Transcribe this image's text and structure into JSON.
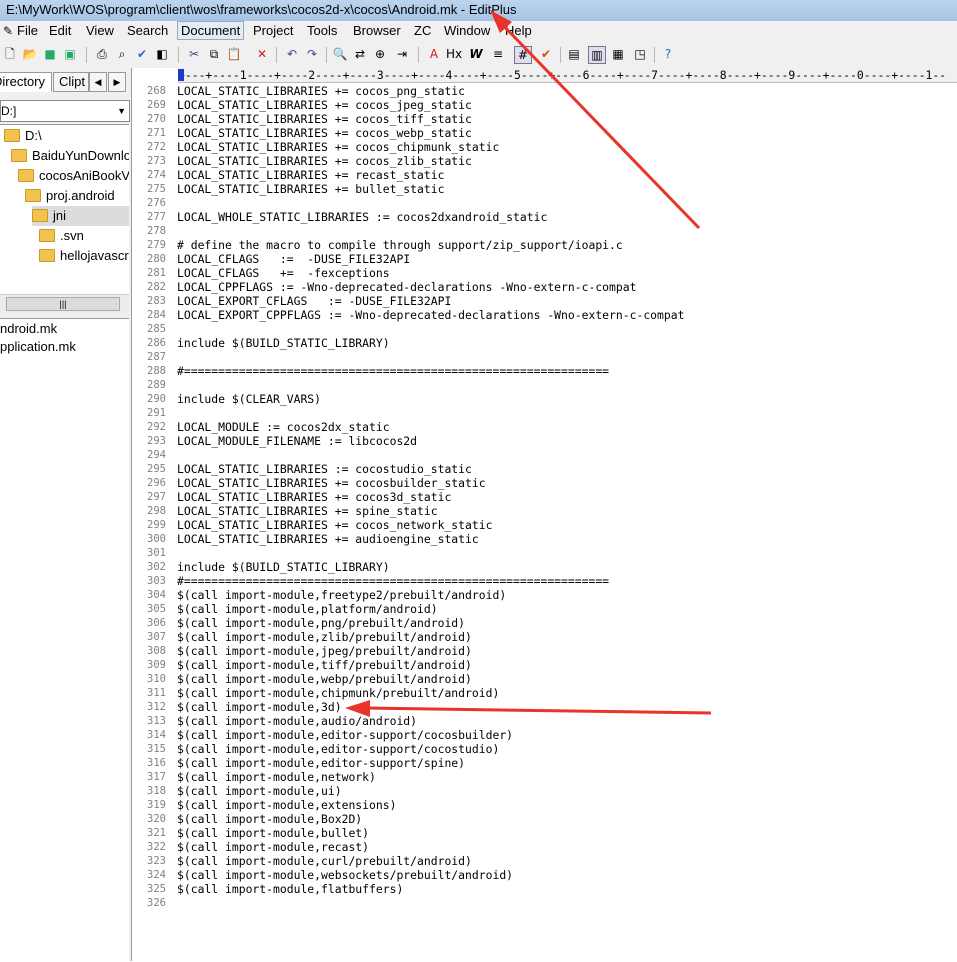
{
  "window": {
    "title": "E:\\MyWork\\WOS\\program\\client\\wos\\frameworks\\cocos2d-x\\cocos\\Android.mk - EditPlus"
  },
  "menu": [
    "File",
    "Edit",
    "View",
    "Search",
    "Document",
    "Project",
    "Tools",
    "Browser",
    "ZC",
    "Window",
    "Help"
  ],
  "active_menu": "Document",
  "left_panel": {
    "tabs": [
      "Directory",
      "Clipt"
    ],
    "drive": "D:]",
    "tree": [
      {
        "label": "D:\\",
        "indent": 0
      },
      {
        "label": "BaiduYunDownlo",
        "indent": 1
      },
      {
        "label": "cocosAniBookV.",
        "indent": 2
      },
      {
        "label": "proj.android",
        "indent": 3
      },
      {
        "label": "jni",
        "indent": 4
      },
      {
        "label": ".svn",
        "indent": 5
      },
      {
        "label": "hellojavascrip",
        "indent": 5
      }
    ],
    "files": [
      "ndroid.mk",
      "pplication.mk"
    ]
  },
  "ruler": "+---+----1----+----2----+----3----+----4----+----5----+----6----+----7----+----8----+----9----+----0----+----1--",
  "lines": [
    {
      "n": "268",
      "t": "LOCAL_STATIC_LIBRARIES += cocos_png_static"
    },
    {
      "n": "269",
      "t": "LOCAL_STATIC_LIBRARIES += cocos_jpeg_static"
    },
    {
      "n": "270",
      "t": "LOCAL_STATIC_LIBRARIES += cocos_tiff_static"
    },
    {
      "n": "271",
      "t": "LOCAL_STATIC_LIBRARIES += cocos_webp_static"
    },
    {
      "n": "272",
      "t": "LOCAL_STATIC_LIBRARIES += cocos_chipmunk_static"
    },
    {
      "n": "273",
      "t": "LOCAL_STATIC_LIBRARIES += cocos_zlib_static"
    },
    {
      "n": "274",
      "t": "LOCAL_STATIC_LIBRARIES += recast_static"
    },
    {
      "n": "275",
      "t": "LOCAL_STATIC_LIBRARIES += bullet_static"
    },
    {
      "n": "276",
      "t": ""
    },
    {
      "n": "277",
      "t": "LOCAL_WHOLE_STATIC_LIBRARIES := cocos2dxandroid_static"
    },
    {
      "n": "278",
      "t": ""
    },
    {
      "n": "279",
      "t": "# define the macro to compile through support/zip_support/ioapi.c"
    },
    {
      "n": "280",
      "t": "LOCAL_CFLAGS   :=  -DUSE_FILE32API"
    },
    {
      "n": "281",
      "t": "LOCAL_CFLAGS   +=  -fexceptions"
    },
    {
      "n": "282",
      "t": "LOCAL_CPPFLAGS := -Wno-deprecated-declarations -Wno-extern-c-compat"
    },
    {
      "n": "283",
      "t": "LOCAL_EXPORT_CFLAGS   := -DUSE_FILE32API"
    },
    {
      "n": "284",
      "t": "LOCAL_EXPORT_CPPFLAGS := -Wno-deprecated-declarations -Wno-extern-c-compat"
    },
    {
      "n": "285",
      "t": ""
    },
    {
      "n": "286",
      "t": "include $(BUILD_STATIC_LIBRARY)"
    },
    {
      "n": "287",
      "t": ""
    },
    {
      "n": "288",
      "t": "#=============================================================="
    },
    {
      "n": "289",
      "t": ""
    },
    {
      "n": "290",
      "t": "include $(CLEAR_VARS)"
    },
    {
      "n": "291",
      "t": ""
    },
    {
      "n": "292",
      "t": "LOCAL_MODULE := cocos2dx_static"
    },
    {
      "n": "293",
      "t": "LOCAL_MODULE_FILENAME := libcocos2d"
    },
    {
      "n": "294",
      "t": ""
    },
    {
      "n": "295",
      "t": "LOCAL_STATIC_LIBRARIES := cocostudio_static"
    },
    {
      "n": "296",
      "t": "LOCAL_STATIC_LIBRARIES += cocosbuilder_static"
    },
    {
      "n": "297",
      "t": "LOCAL_STATIC_LIBRARIES += cocos3d_static"
    },
    {
      "n": "298",
      "t": "LOCAL_STATIC_LIBRARIES += spine_static"
    },
    {
      "n": "299",
      "t": "LOCAL_STATIC_LIBRARIES += cocos_network_static"
    },
    {
      "n": "300",
      "t": "LOCAL_STATIC_LIBRARIES += audioengine_static"
    },
    {
      "n": "301",
      "t": ""
    },
    {
      "n": "302",
      "t": "include $(BUILD_STATIC_LIBRARY)"
    },
    {
      "n": "303",
      "t": "#=============================================================="
    },
    {
      "n": "304",
      "t": "$(call import-module,freetype2/prebuilt/android)"
    },
    {
      "n": "305",
      "t": "$(call import-module,platform/android)"
    },
    {
      "n": "306",
      "t": "$(call import-module,png/prebuilt/android)"
    },
    {
      "n": "307",
      "t": "$(call import-module,zlib/prebuilt/android)"
    },
    {
      "n": "308",
      "t": "$(call import-module,jpeg/prebuilt/android)"
    },
    {
      "n": "309",
      "t": "$(call import-module,tiff/prebuilt/android)"
    },
    {
      "n": "310",
      "t": "$(call import-module,webp/prebuilt/android)"
    },
    {
      "n": "311",
      "t": "$(call import-module,chipmunk/prebuilt/android)"
    },
    {
      "n": "312",
      "t": "$(call import-module,3d)"
    },
    {
      "n": "313",
      "t": "$(call import-module,audio/android)"
    },
    {
      "n": "314",
      "t": "$(call import-module,editor-support/cocosbuilder)"
    },
    {
      "n": "315",
      "t": "$(call import-module,editor-support/cocostudio)"
    },
    {
      "n": "316",
      "t": "$(call import-module,editor-support/spine)"
    },
    {
      "n": "317",
      "t": "$(call import-module,network)"
    },
    {
      "n": "318",
      "t": "$(call import-module,ui)"
    },
    {
      "n": "319",
      "t": "$(call import-module,extensions)"
    },
    {
      "n": "320",
      "t": "$(call import-module,Box2D)"
    },
    {
      "n": "321",
      "t": "$(call import-module,bullet)"
    },
    {
      "n": "322",
      "t": "$(call import-module,recast)"
    },
    {
      "n": "323",
      "t": "$(call import-module,curl/prebuilt/android)"
    },
    {
      "n": "324",
      "t": "$(call import-module,websockets/prebuilt/android)"
    },
    {
      "n": "325",
      "t": "$(call import-module,flatbuffers)"
    },
    {
      "n": "326",
      "t": ""
    }
  ],
  "colors": {
    "annotation_arrow": "#e8342a",
    "title_bar": "#bcd5ee",
    "line_number": "#808080"
  }
}
